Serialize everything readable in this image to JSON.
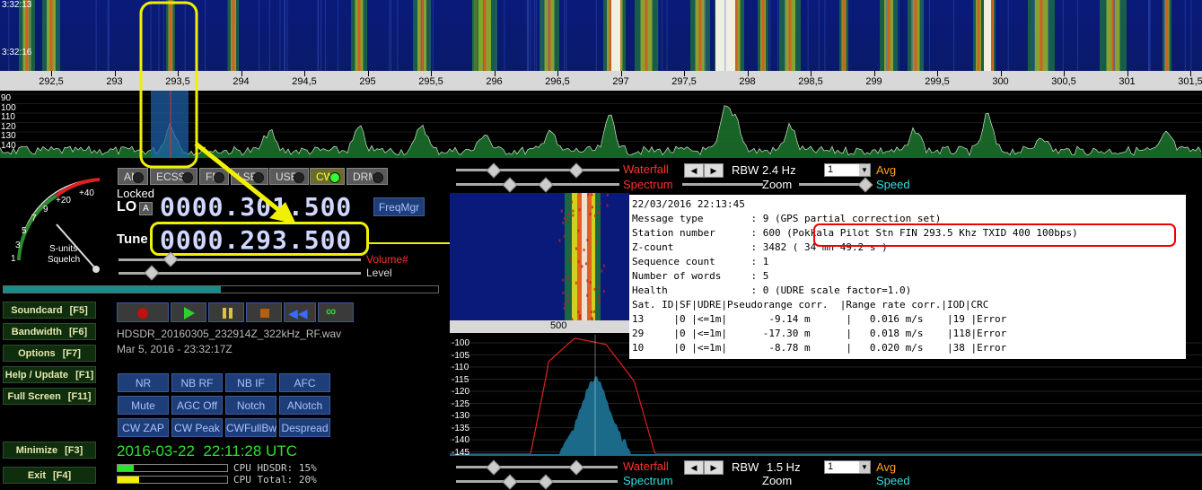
{
  "waterfall": {
    "times": [
      "3:32:13",
      "3:32:16"
    ],
    "freq_labels": [
      "292,5",
      "293",
      "293,5",
      "294",
      "294,5",
      "295",
      "295,5",
      "296",
      "296,5",
      "297",
      "297,5",
      "298",
      "298,5",
      "299",
      "299,5",
      "300",
      "300,5",
      "301",
      "301,5"
    ]
  },
  "spectrum": {
    "db_labels": [
      "90",
      "100",
      "110",
      "120",
      "130",
      "140"
    ]
  },
  "modes": [
    {
      "label": "AM",
      "active": false
    },
    {
      "label": "ECSS",
      "active": false
    },
    {
      "label": "FM",
      "active": false
    },
    {
      "label": "LSB",
      "active": false
    },
    {
      "label": "USB",
      "active": false
    },
    {
      "label": "CW",
      "active": true
    },
    {
      "label": "DRM",
      "active": false
    }
  ],
  "smeter": {
    "scale": [
      "+40",
      "+20",
      "9",
      "7",
      "5",
      "3",
      "1"
    ],
    "label1": "S-units",
    "label2": "Squelch"
  },
  "lo": {
    "locked": "Locked",
    "label": "LO",
    "badge": "A",
    "value": "0000.301.500",
    "freqmgr": "FreqMgr"
  },
  "tune": {
    "label": "Tune",
    "value": "0000.293.500"
  },
  "volume": {
    "label": "Volume#",
    "level_label": "Level"
  },
  "side_buttons": [
    {
      "label": "Soundcard",
      "key": "[F5]"
    },
    {
      "label": "Bandwidth",
      "key": "[F6]"
    },
    {
      "label": "Options",
      "key": "[F7]"
    },
    {
      "label": "Help / Update",
      "key": "[F1]"
    },
    {
      "label": "Full Screen",
      "key": "[F11]"
    },
    {
      "label": "Minimize",
      "key": "[F3]"
    },
    {
      "label": "Exit",
      "key": "[F4]"
    }
  ],
  "recording": {
    "filename": "HDSDR_20160305_232914Z_322kHz_RF.wav",
    "date": "Mar 5, 2016 - 23:32:17Z"
  },
  "dsp_buttons": [
    "NR",
    "NB RF",
    "NB IF",
    "AFC",
    "Mute",
    "AGC Off",
    "Notch",
    "ANotch",
    "CW ZAP",
    "CW Peak",
    "CWFullBw",
    "Despread"
  ],
  "clock": {
    "date": "2016-03-22",
    "time": "22:11:28 UTC"
  },
  "cpu": {
    "hdsdr": "CPU HDSDR: 15%",
    "total": "CPU Total: 20%"
  },
  "top_controls": {
    "waterfall": "Waterfall",
    "spectrum": "Spectrum",
    "rbw_label": "RBW",
    "rbw_value": "2.4 Hz",
    "avg_value": "1",
    "avg": "Avg",
    "zoom": "Zoom",
    "speed": "Speed"
  },
  "bottom_controls": {
    "waterfall": "Waterfall",
    "spectrum": "Spectrum",
    "rbw_label": "RBW",
    "rbw_value": "1.5 Hz",
    "avg_value": "1",
    "avg": "Avg",
    "zoom": "Zoom",
    "speed": "Speed"
  },
  "af_waterfall": {
    "label": "500"
  },
  "af_spectrum": {
    "db_labels": [
      "-100",
      "-105",
      "-110",
      "-115",
      "-120",
      "-125",
      "-130",
      "-135",
      "-140",
      "-145"
    ]
  },
  "decoder": {
    "lines": [
      "22/03/2016 22:13:45",
      "Message type        : 9 (GPS partial correction set)",
      "Station number      : 600 (Pokkala Pilot Stn FIN 293.5 Khz TXID 400 100bps)",
      "Z-count             : 3482 ( 34 mn 49.2 s )",
      "Sequence count      : 1",
      "Number of words     : 5",
      "Health              : 0 (UDRE scale factor=1.0)",
      "Sat. ID|SF|UDRE|Pseudorange corr.  |Range rate corr.|IOD|CRC",
      "13     |0 |<=1m|       -9.14 m      |   0.016 m/s    |19 |Error",
      "29     |0 |<=1m|      -17.30 m      |   0.018 m/s    |118|Error",
      "10     |0 |<=1m|       -8.78 m      |   0.020 m/s    |38 |Error"
    ]
  }
}
